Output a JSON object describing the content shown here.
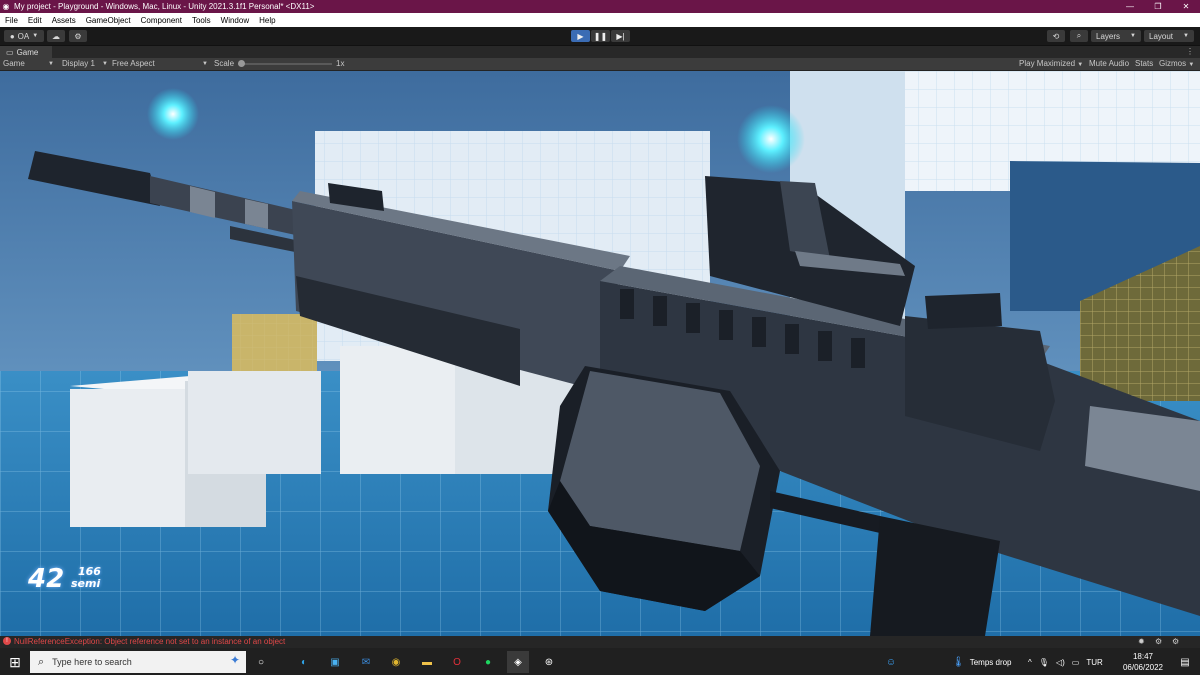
{
  "window": {
    "title": "My project - Playground - Windows, Mac, Linux - Unity 2021.3.1f1 Personal* <DX11>",
    "controls": [
      "—",
      "❐",
      "✕"
    ]
  },
  "menu": [
    "File",
    "Edit",
    "Assets",
    "GameObject",
    "Component",
    "Tools",
    "Window",
    "Help"
  ],
  "toolbar": {
    "account": "OA",
    "layers": "Layers",
    "layout": "Layout"
  },
  "game_tab": {
    "tab_label": "Game",
    "view_select": "Game",
    "display": "Display 1",
    "aspect": "Free Aspect",
    "scale_label": "Scale",
    "scale_value": "1x",
    "play_maximized": "Play Maximized",
    "mute_audio": "Mute Audio",
    "stats": "Stats",
    "gizmos": "Gizmos"
  },
  "hud": {
    "ammo_count": "42",
    "reserve_ammo": "166",
    "ammo_type": "semi"
  },
  "console": {
    "error_message": "NullReferenceException: Object reference not set to an instance of an object"
  },
  "taskbar": {
    "search_placeholder": "Type here to search",
    "weather": "Temps drop",
    "language": "TUR",
    "time": "18:47",
    "date": "06/06/2022"
  },
  "colors": {
    "title_bar": "#6a1548",
    "play_active": "#3b6cb4",
    "error_text": "#e04848",
    "hud_text": "#ffffff"
  }
}
